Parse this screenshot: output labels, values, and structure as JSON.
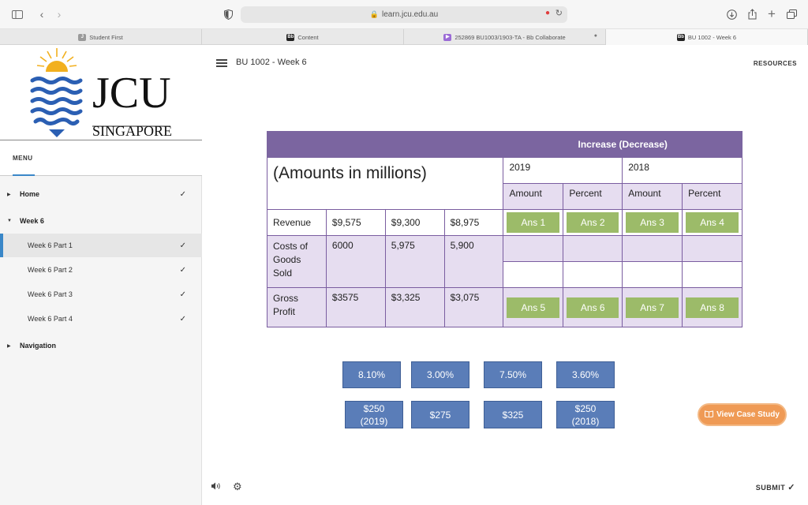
{
  "browser": {
    "url": "learn.jcu.edu.au",
    "tabs": [
      {
        "label": "Student First",
        "active": false
      },
      {
        "label": "Content",
        "active": false
      },
      {
        "label": "252869 BU1003/1903-TA - Bb Collaborate",
        "active": false
      },
      {
        "label": "BU 1002 - Week 6",
        "active": true
      }
    ]
  },
  "logo": {
    "name": "JCU",
    "sub": "SINGAPORE"
  },
  "sidebar": {
    "menu_label": "MENU",
    "items": [
      {
        "label": "Home"
      },
      {
        "label": "Week 6"
      },
      {
        "label": "Week 6 Part 1"
      },
      {
        "label": "Week 6 Part 2"
      },
      {
        "label": "Week 6 Part 3"
      },
      {
        "label": "Week 6 Part 4"
      },
      {
        "label": "Navigation"
      }
    ]
  },
  "header": {
    "title": "BU 1002 - Week 6",
    "resources": "RESOURCES"
  },
  "table": {
    "heading": "Increase (Decrease)",
    "amounts_label": "(Amounts in millions)",
    "year_a": "2019",
    "year_b": "2018",
    "col_amount": "Amount",
    "col_percent": "Percent",
    "rows": [
      {
        "label": "Revenue",
        "v1": "$9,575",
        "v2": "$9,300",
        "v3": "$8,975",
        "a": [
          "Ans 1",
          "Ans 2",
          "Ans 3",
          "Ans 4"
        ]
      },
      {
        "label": "Costs of Goods Sold",
        "v1": "6000",
        "v2": "5,975",
        "v3": "5,900"
      },
      {
        "label": "Gross Profit",
        "v1": "$3575",
        "v2": "$3,325",
        "v3": "$3,075",
        "a": [
          "Ans 5",
          "Ans 6",
          "Ans 7",
          "Ans 8"
        ]
      }
    ]
  },
  "options": [
    {
      "label": "8.10%"
    },
    {
      "label": "3.00%"
    },
    {
      "label": "7.50%"
    },
    {
      "label": "3.60%"
    },
    {
      "label": "$250\n(2019)"
    },
    {
      "label": "$275"
    },
    {
      "label": "$325"
    },
    {
      "label": "$250\n(2018)"
    }
  ],
  "case_study": "View Case Study",
  "submit": "SUBMIT",
  "colors": {
    "accent": "#3a87c8",
    "table_header": "#7b65a0",
    "answer_slot": "#9cbb69",
    "option": "#5a7db8",
    "case_button": "#ef9a55"
  }
}
